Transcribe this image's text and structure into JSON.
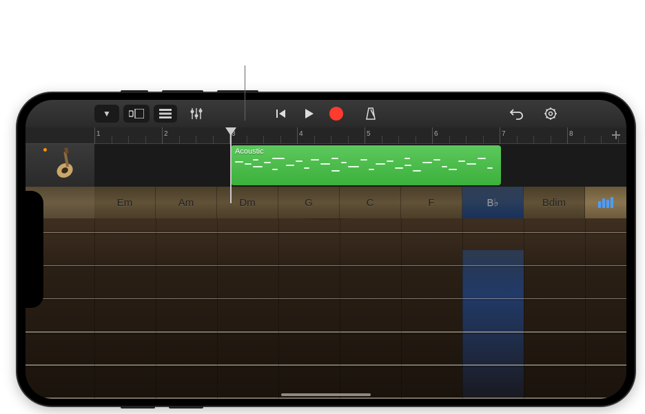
{
  "annotation": {
    "present": true
  },
  "toolbar": {
    "browser_label": "▼",
    "view_label": "view",
    "tracks_label": "tracks",
    "mixer_label": "mixer"
  },
  "ruler": {
    "bars": [
      "1",
      "2",
      "3",
      "4",
      "5",
      "6",
      "7",
      "8"
    ],
    "playhead_bar": 3
  },
  "track": {
    "instrument": "guitar",
    "region_label": "Acoustic",
    "region_start_bar": 3,
    "region_end_bar": 7
  },
  "chords": [
    "Em",
    "Am",
    "Dm",
    "G",
    "C",
    "F",
    "B♭",
    "Bdim"
  ],
  "active_chord_index": 6,
  "strings_count": 6
}
